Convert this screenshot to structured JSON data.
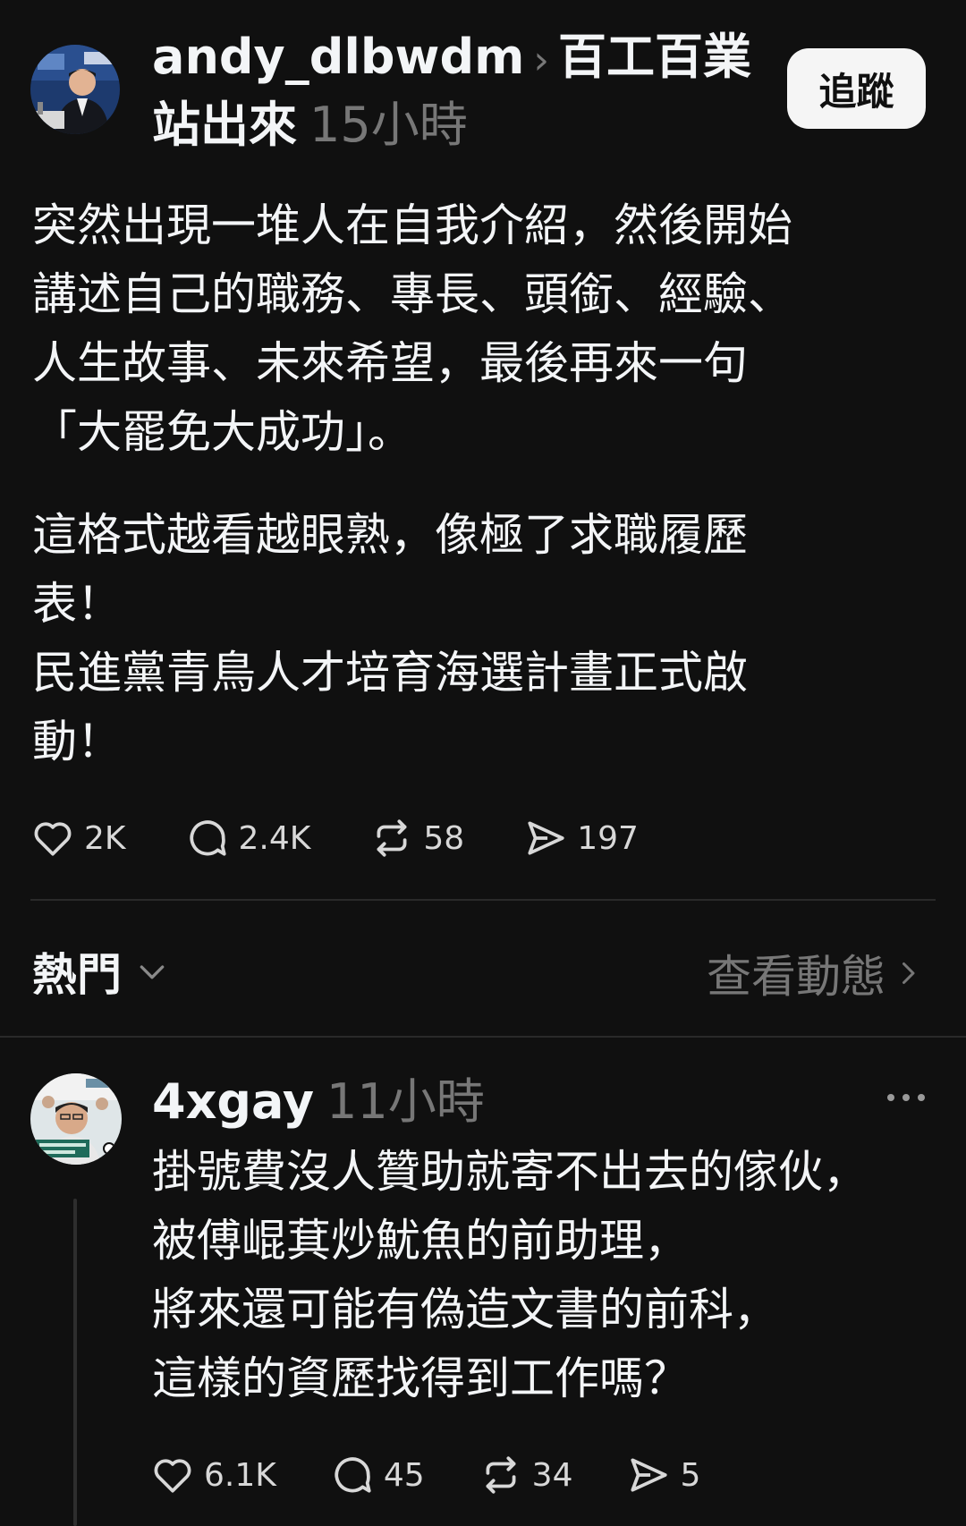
{
  "post": {
    "username": "andy_dlbwdm",
    "community": "百工百業站出來",
    "time": "15小時",
    "follow_label": "追蹤",
    "paragraphs": [
      "突然出現一堆人在自我介紹，然後開始\n講述自己的職務、專長、頭銜、經驗、\n人生故事、未來希望，最後再來一句\n「大罷免大成功」。",
      "這格式越看越眼熟，像極了求職履歷\n表！\n民進黨青鳥人才培育海選計畫正式啟\n動！"
    ],
    "stats": {
      "likes": "2K",
      "comments": "2.4K",
      "reposts": "58",
      "shares": "197"
    }
  },
  "sort": {
    "label": "熱門",
    "activity_label": "查看動態"
  },
  "reply": {
    "username": "4xgay",
    "time": "11小時",
    "text": "掛號費沒人贊助就寄不出去的傢伙，\n被傅崐萁炒魷魚的前助理，\n將來還可能有偽造文書的前科，\n這樣的資歷找得到工作嗎？",
    "stats": {
      "likes": "6.1K",
      "comments": "45",
      "reposts": "34",
      "shares": "5"
    }
  },
  "colors": {
    "background": "#101010",
    "text": "#f3f5f7",
    "muted": "#777777",
    "button_bg": "#f5f5f5"
  },
  "icons": [
    "heart-icon",
    "comment-icon",
    "repost-icon",
    "share-icon",
    "chevron-down-icon",
    "chevron-right-icon",
    "more-icon"
  ]
}
